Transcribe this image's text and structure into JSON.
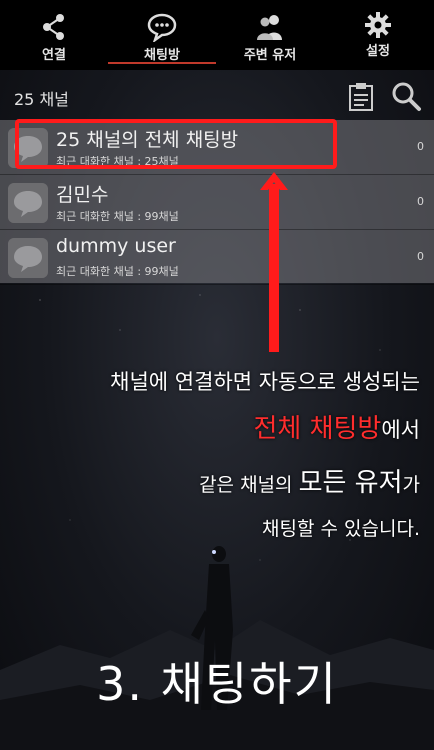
{
  "colors": {
    "accent": "#ff2d2d",
    "tab_indicator": "#c0392b",
    "highlight_box": "#ff1b1b"
  },
  "tabs": [
    {
      "label": "연결",
      "icon": "share-icon"
    },
    {
      "label": "채팅방",
      "icon": "chat-bubble-icon",
      "selected": true
    },
    {
      "label": "주변 유저",
      "icon": "users-icon"
    },
    {
      "label": "설정",
      "icon": "gear-icon"
    }
  ],
  "header": {
    "title": "25 채널",
    "actions": [
      {
        "icon": "clipboard-icon"
      },
      {
        "icon": "search-icon"
      }
    ]
  },
  "chat_rooms": [
    {
      "name": "25 채널의 전체 채팅방",
      "subtitle": "최근 대화한 채널 : 25채널",
      "count": "0"
    },
    {
      "name": "김민수",
      "subtitle": "최근 대화한 채널 : 99채널",
      "count": "0"
    },
    {
      "name": "dummy user",
      "subtitle": "최근 대화한 채널 : 99채널",
      "count": "0"
    }
  ],
  "caption": {
    "line1": "채널에 연결하면 자동으로 생성되는",
    "line2_accent": "전체 채팅방",
    "line2_rest": "에서",
    "line3_a": "같은 채널의 ",
    "line3_b": "모든 유저",
    "line3_c": "가",
    "line4": "채팅할 수 있습니다."
  },
  "step_title": "3. 채팅하기"
}
